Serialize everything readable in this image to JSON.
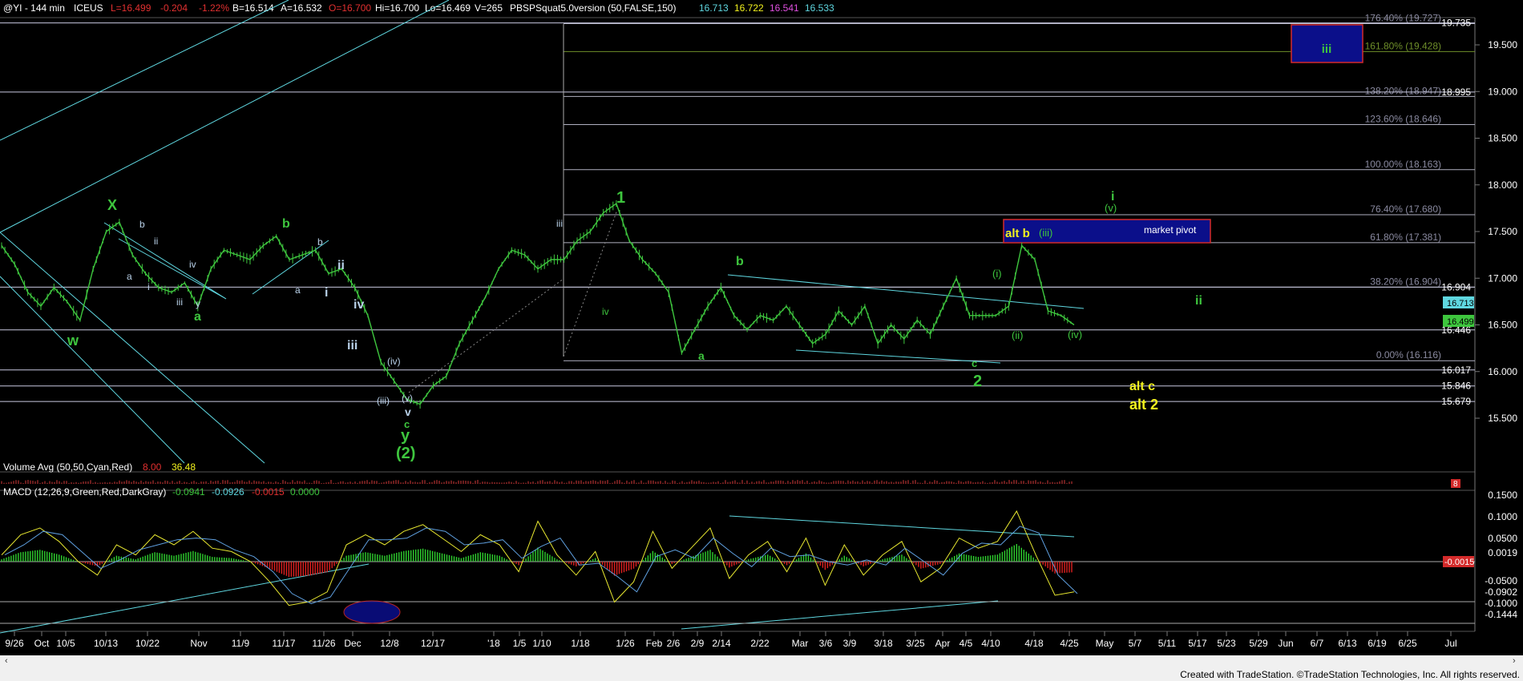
{
  "header": {
    "symbol": "@YI - 144 min",
    "exchange": "ICEUS",
    "last": "L=16.499",
    "change": "-0.204",
    "pct": "-1.22%",
    "bid": "B=16.514",
    "ask": "A=16.532",
    "open": "O=16.700",
    "high": "Hi=16.700",
    "low": "Lo=16.469",
    "volume": "V=265",
    "study": "PBSPSquat5.0version (50,FALSE,150)",
    "study_values": [
      "16.713",
      "16.722",
      "16.541",
      "16.533"
    ]
  },
  "volume_header": {
    "label": "Volume Avg (50,50,Cyan,Red)",
    "v1": "8.00",
    "v2": "36.48"
  },
  "macd_header": {
    "label": "MACD (12,26,9,Green,Red,DarkGray)",
    "v1": "-0.0941",
    "v2": "-0.0926",
    "v3": "-0.0015",
    "v4": "0.0000"
  },
  "footer": "Created with TradeStation. ©TradeStation Technologies, Inc. All rights reserved.",
  "colors": {
    "green": "#3ec63e",
    "cyan": "#5fd7e0",
    "yellow": "#f2f21e",
    "fib_green": "#6f8f2a",
    "navy": "#0b0f8a",
    "red": "#d42a2a"
  },
  "chart_data": {
    "type": "line",
    "title": "",
    "ylim": [
      15.0,
      20.0
    ],
    "y_ticks": [
      15.5,
      16.0,
      16.5,
      17.0,
      17.5,
      18.0,
      18.5,
      19.0,
      19.5
    ],
    "x_tick_labels": [
      "9/26",
      "Oct",
      "10/5",
      "10/13",
      "10/22",
      "Nov",
      "11/9",
      "11/17",
      "11/26",
      "Dec",
      "12/8",
      "12/17",
      "'18",
      "1/5",
      "1/10",
      "1/18",
      "1/26",
      "Feb",
      "2/6",
      "2/9",
      "2/14",
      "2/22",
      "Mar",
      "3/6",
      "3/9",
      "3/18",
      "3/25",
      "Apr",
      "4/5",
      "4/10",
      "4/18",
      "4/25",
      "May",
      "5/7",
      "5/11",
      "5/17",
      "5/23",
      "5/29",
      "Jun",
      "6/7",
      "6/13",
      "6/19",
      "6/25",
      "Jul"
    ],
    "price_series": {
      "name": "@YI",
      "values": [
        17.35,
        17.15,
        16.85,
        16.7,
        16.9,
        16.75,
        16.55,
        17.1,
        17.5,
        17.6,
        17.25,
        17.05,
        16.9,
        16.85,
        16.95,
        16.7,
        17.1,
        17.3,
        17.25,
        17.2,
        17.35,
        17.45,
        17.2,
        17.25,
        17.3,
        17.05,
        17.1,
        16.9,
        16.6,
        16.1,
        15.9,
        15.7,
        15.65,
        15.85,
        15.95,
        16.3,
        16.55,
        16.8,
        17.1,
        17.3,
        17.25,
        17.1,
        17.2,
        17.2,
        17.4,
        17.5,
        17.7,
        17.8,
        17.4,
        17.2,
        17.05,
        16.85,
        16.2,
        16.45,
        16.7,
        16.9,
        16.6,
        16.45,
        16.6,
        16.55,
        16.7,
        16.5,
        16.3,
        16.4,
        16.65,
        16.5,
        16.7,
        16.3,
        16.5,
        16.35,
        16.55,
        16.4,
        16.7,
        17.0,
        16.6,
        16.6,
        16.6,
        16.7,
        17.35,
        17.2,
        16.65,
        16.6,
        16.5
      ]
    },
    "fib_levels": [
      {
        "label": "176.40% (19.727)",
        "value": 19.727
      },
      {
        "label": "161.80% (19.428)",
        "value": 19.428
      },
      {
        "label": "138.20% (18.947)",
        "value": 18.947
      },
      {
        "label": "123.60% (18.646)",
        "value": 18.646
      },
      {
        "label": "100.00% (18.163)",
        "value": 18.163
      },
      {
        "label": "76.40% (17.680)",
        "value": 17.68
      },
      {
        "label": "61.80% (17.381)",
        "value": 17.381
      },
      {
        "label": "38.20% (16.904)",
        "value": 16.904
      },
      {
        "label": "0.00% (16.116)",
        "value": 16.116
      }
    ],
    "price_levels": [
      "19.735",
      "18.995",
      "16.904",
      "16.446",
      "16.017",
      "15.846",
      "15.679"
    ],
    "price_level_values": [
      19.735,
      18.995,
      16.904,
      16.446,
      16.017,
      15.846,
      15.679
    ],
    "current_prices": [
      "16.713",
      "16.499"
    ],
    "boxes": [
      {
        "label": "iii",
        "color": "#3ec63e"
      },
      {
        "label": "alt b",
        "label2": "(iii)",
        "label3": "market pivot"
      }
    ],
    "wave_labels": {
      "green": [
        "X",
        "w",
        "b",
        "a",
        "1",
        "a",
        "b",
        "2",
        "i",
        "(v)",
        "ii",
        "(i)",
        "(ii)",
        "(iv)",
        "c",
        "y",
        "(2)",
        "iv",
        "v"
      ],
      "white": [
        "b",
        "ii",
        "iv",
        "a",
        "i",
        "iii",
        "y",
        "iii",
        "ii",
        "iv",
        "i",
        "a",
        "b",
        "c",
        "iii",
        "(iv)",
        "(iii)",
        "(v)",
        "v",
        "iii"
      ],
      "yellow": [
        "alt c",
        "alt 2"
      ]
    },
    "macd_ticks": [
      "0.1500",
      "0.1000",
      "0.0500",
      "0.0019",
      "-0.0015",
      "-0.0500",
      "-0.0902",
      "-0.1000",
      "-0.1444"
    ],
    "volume_tick": "8",
    "macd_series": [
      0.02,
      0.08,
      0.1,
      0.06,
      0.0,
      -0.04,
      0.05,
      0.02,
      0.08,
      0.05,
      0.09,
      0.04,
      0.03,
      0.0,
      -0.06,
      -0.13,
      -0.12,
      -0.09,
      0.05,
      0.08,
      0.05,
      0.09,
      0.11,
      0.07,
      0.03,
      0.08,
      0.05,
      -0.03,
      0.12,
      0.02,
      -0.04,
      0.03,
      -0.12,
      -0.06,
      0.09,
      -0.02,
      0.04,
      0.1,
      -0.05,
      0.02,
      0.06,
      -0.03,
      0.07,
      -0.07,
      0.05,
      -0.04,
      0.02,
      0.06,
      -0.06,
      -0.02,
      0.07,
      0.04,
      0.06,
      0.15,
      0.02,
      -0.1,
      -0.09
    ]
  }
}
